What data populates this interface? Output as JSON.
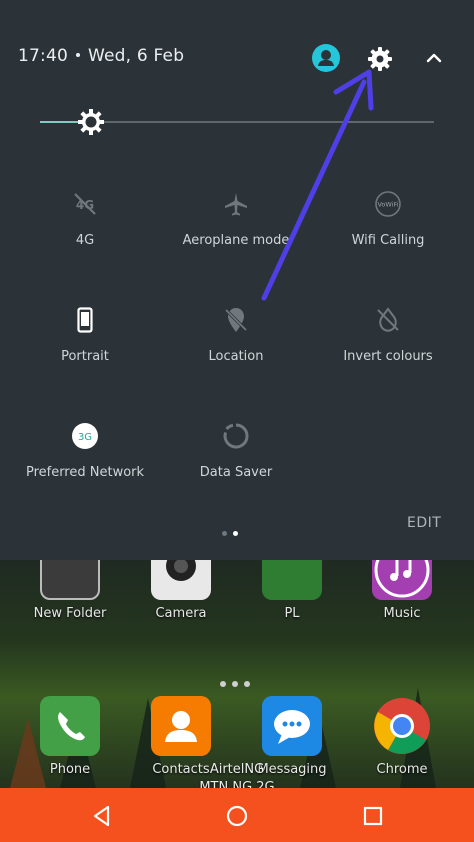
{
  "status": {
    "time": "17:40",
    "date": "Wed, 6 Feb"
  },
  "brightness": {
    "level": 0.13
  },
  "tiles": [
    {
      "label": "4G",
      "icon": "mobile-data-off-icon",
      "active": false
    },
    {
      "label": "Aeroplane mode",
      "icon": "airplane-icon",
      "active": false
    },
    {
      "label": "Wifi Calling",
      "icon": "vowifi-icon",
      "badge": "VoWiFi",
      "active": false
    },
    {
      "label": "Portrait",
      "icon": "portrait-phone-icon",
      "active": true
    },
    {
      "label": "Location",
      "icon": "location-off-icon",
      "active": false
    },
    {
      "label": "Invert colours",
      "icon": "invert-colours-icon",
      "active": false
    },
    {
      "label": "Preferred Network",
      "icon": "network-3g-icon",
      "badge": "3G",
      "active": true
    },
    {
      "label": "Data Saver",
      "icon": "data-saver-icon",
      "active": false
    }
  ],
  "edit_label": "EDIT",
  "home": {
    "top_apps": [
      {
        "name": "New Folder",
        "color": "#3b3b3b"
      },
      {
        "name": "Camera",
        "color": "#e8e8e8"
      },
      {
        "name": "PL",
        "color": "#2e7d32"
      },
      {
        "name": "Music",
        "color": "#a33fb0"
      }
    ],
    "dock_apps": [
      {
        "name": "Phone",
        "color": "#43a047"
      },
      {
        "name": "Contacts",
        "color": "#f57c00"
      },
      {
        "name": "Messaging",
        "color": "#1e88e5"
      },
      {
        "name": "Chrome",
        "color": "#f5f5f5"
      }
    ],
    "carrier_1": "AirtelNG",
    "carrier_2": "MTN NG 2G"
  },
  "colors": {
    "panel_bg": "#2c3338",
    "accent": "#80cbc4",
    "avatar": "#26c6da",
    "navbar": "#f4511e",
    "arrow": "#4f3fe6"
  }
}
